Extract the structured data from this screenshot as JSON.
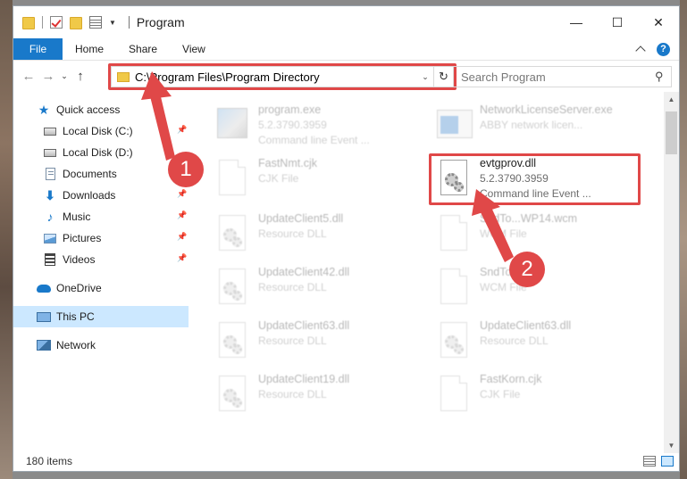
{
  "window": {
    "title": "Program",
    "controls": {
      "minimize": "—",
      "maximize": "☐",
      "close": "✕"
    }
  },
  "ribbon": {
    "file": "File",
    "tabs": [
      "Home",
      "Share",
      "View"
    ],
    "help": "?"
  },
  "nav": {
    "back": "←",
    "forward": "→",
    "recent": "⌄",
    "up": "↑"
  },
  "address": {
    "path": "C:\\Program Files\\Program Directory",
    "dropdown": "⌄",
    "refresh": "↻"
  },
  "search": {
    "placeholder": "Search Program",
    "icon": "⚲"
  },
  "sidebar": {
    "items": [
      {
        "label": "Quick access",
        "icon": "star-icon",
        "pinned": false
      },
      {
        "label": "Local Disk (C:)",
        "icon": "drive-icon",
        "pinned": true
      },
      {
        "label": "Local Disk (D:)",
        "icon": "drive-icon",
        "pinned": false
      },
      {
        "label": "Documents",
        "icon": "documents-icon",
        "pinned": true
      },
      {
        "label": "Downloads",
        "icon": "downloads-icon",
        "pinned": true
      },
      {
        "label": "Music",
        "icon": "music-icon",
        "pinned": true
      },
      {
        "label": "Pictures",
        "icon": "pictures-icon",
        "pinned": true
      },
      {
        "label": "Videos",
        "icon": "videos-icon",
        "pinned": true
      },
      {
        "label": "OneDrive",
        "icon": "onedrive-icon",
        "pinned": false
      },
      {
        "label": "This PC",
        "icon": "this-pc-icon",
        "pinned": false,
        "selected": true
      },
      {
        "label": "Network",
        "icon": "network-icon",
        "pinned": false
      }
    ]
  },
  "files": [
    {
      "name": "program.exe",
      "line2": "5.2.3790.3959",
      "line3": "Command line Event ...",
      "icon": "exe-icon",
      "faded": true
    },
    {
      "name": "NetworkLicenseServer.exe",
      "line2": "ABBY network licen...",
      "line3": "",
      "icon": "app-window-icon",
      "faded": true
    },
    {
      "name": "FastNmt.cjk",
      "line2": "CJK File",
      "line3": "",
      "icon": "blank-file-icon",
      "faded": true
    },
    {
      "name": "evtgprov.dll",
      "line2": "5.2.3790.3959",
      "line3": "Command line Event ...",
      "icon": "dll-gear-icon",
      "faded": false,
      "highlighted": true
    },
    {
      "name": "UpdateClient5.dll",
      "line2": "Resource DLL",
      "line3": "",
      "icon": "dll-gear-icon",
      "faded": true
    },
    {
      "name": "SndTo...WP14.wcm",
      "line2": "WCM File",
      "line3": "",
      "icon": "blank-file-icon",
      "faded": true
    },
    {
      "name": "UpdateClient42.dll",
      "line2": "Resource DLL",
      "line3": "",
      "icon": "dll-gear-icon",
      "faded": true
    },
    {
      "name": "SndTo...wcm",
      "line2": "WCM File",
      "line3": "",
      "icon": "blank-file-icon",
      "faded": true
    },
    {
      "name": "UpdateClient63.dll",
      "line2": "Resource DLL",
      "line3": "",
      "icon": "dll-gear-icon",
      "faded": true
    },
    {
      "name": "UpdateClient63.dll",
      "line2": "Resource DLL",
      "line3": "",
      "icon": "dll-gear-icon",
      "faded": true
    },
    {
      "name": "UpdateClient19.dll",
      "line2": "Resource DLL",
      "line3": "",
      "icon": "dll-gear-icon",
      "faded": true
    },
    {
      "name": "FastKorn.cjk",
      "line2": "CJK File",
      "line3": "",
      "icon": "blank-file-icon",
      "faded": true
    }
  ],
  "callouts": [
    "1",
    "2"
  ],
  "status": {
    "items": "180 items"
  },
  "colors": {
    "accent": "#1979ca",
    "highlight": "#e04848",
    "selected": "#cce8ff"
  }
}
